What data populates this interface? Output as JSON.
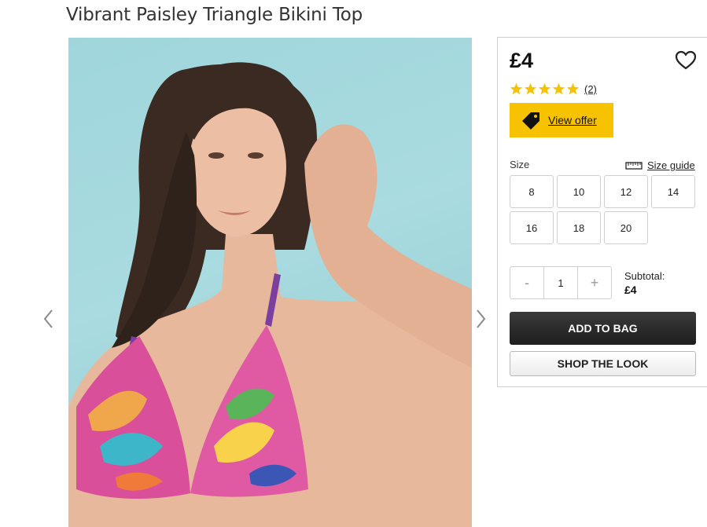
{
  "product": {
    "title": "Vibrant Paisley Triangle Bikini Top",
    "price": "£4",
    "rating": {
      "stars": 5,
      "max": 5,
      "review_count": "(2)"
    },
    "offer_label": "View offer"
  },
  "gallery": {
    "prev_icon": "chevron-left-icon",
    "next_icon": "chevron-right-icon"
  },
  "size": {
    "label": "Size",
    "guide_label": "Size guide",
    "options": [
      "8",
      "10",
      "12",
      "14",
      "16",
      "18",
      "20"
    ]
  },
  "quantity": {
    "minus": "-",
    "value": "1",
    "plus": "+"
  },
  "subtotal": {
    "label": "Subtotal:",
    "value": "£4"
  },
  "actions": {
    "add_to_bag": "ADD TO BAG",
    "shop_the_look": "SHOP THE LOOK"
  },
  "colors": {
    "star": "#f7c300",
    "offer_bg": "#f7c300",
    "primary_button": "#222222",
    "image_bg": "#a9dbe0"
  }
}
